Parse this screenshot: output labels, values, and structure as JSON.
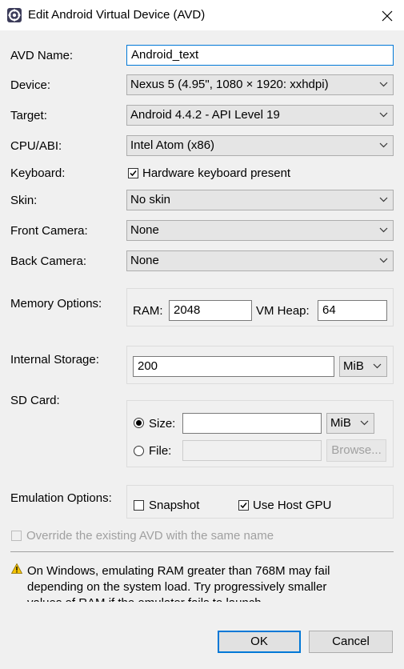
{
  "window": {
    "title": "Edit Android Virtual Device (AVD)",
    "icons": {
      "app": "eclipse-gear-icon",
      "close": "close-icon"
    }
  },
  "form": {
    "avd_name": {
      "label": "AVD Name:",
      "value": "Android_text"
    },
    "device": {
      "label": "Device:",
      "value": "Nexus 5 (4.95\", 1080 × 1920: xxhdpi)"
    },
    "target": {
      "label": "Target:",
      "value": "Android 4.4.2 - API Level 19"
    },
    "cpu_abi": {
      "label": "CPU/ABI:",
      "value": "Intel Atom (x86)"
    },
    "keyboard": {
      "label": "Keyboard:",
      "checkbox_label": "Hardware keyboard present",
      "checked": true
    },
    "skin": {
      "label": "Skin:",
      "value": "No skin"
    },
    "front_camera": {
      "label": "Front Camera:",
      "value": "None"
    },
    "back_camera": {
      "label": "Back Camera:",
      "value": "None"
    },
    "memory": {
      "label": "Memory Options:",
      "ram_label": "RAM:",
      "ram_value": "2048",
      "vm_heap_label": "VM Heap:",
      "vm_heap_value": "64"
    },
    "internal_storage": {
      "label": "Internal Storage:",
      "value": "200",
      "unit": "MiB"
    },
    "sd_card": {
      "label": "SD Card:",
      "size_label": "Size:",
      "size_value": "",
      "size_unit": "MiB",
      "size_selected": true,
      "file_label": "File:",
      "file_value": "",
      "browse_label": "Browse..."
    },
    "emulation": {
      "label": "Emulation Options:",
      "snapshot_label": "Snapshot",
      "snapshot_checked": false,
      "host_gpu_label": "Use Host GPU",
      "host_gpu_checked": true
    },
    "override": {
      "label": "Override the existing AVD with the same name",
      "checked": false
    }
  },
  "warning": {
    "icon": "warning-icon",
    "line1": "On Windows, emulating RAM greater than 768M may fail",
    "line2": "depending on the system load. Try progressively smaller",
    "line3": "values of RAM if the emulator fails to launch."
  },
  "buttons": {
    "ok": "OK",
    "cancel": "Cancel"
  }
}
